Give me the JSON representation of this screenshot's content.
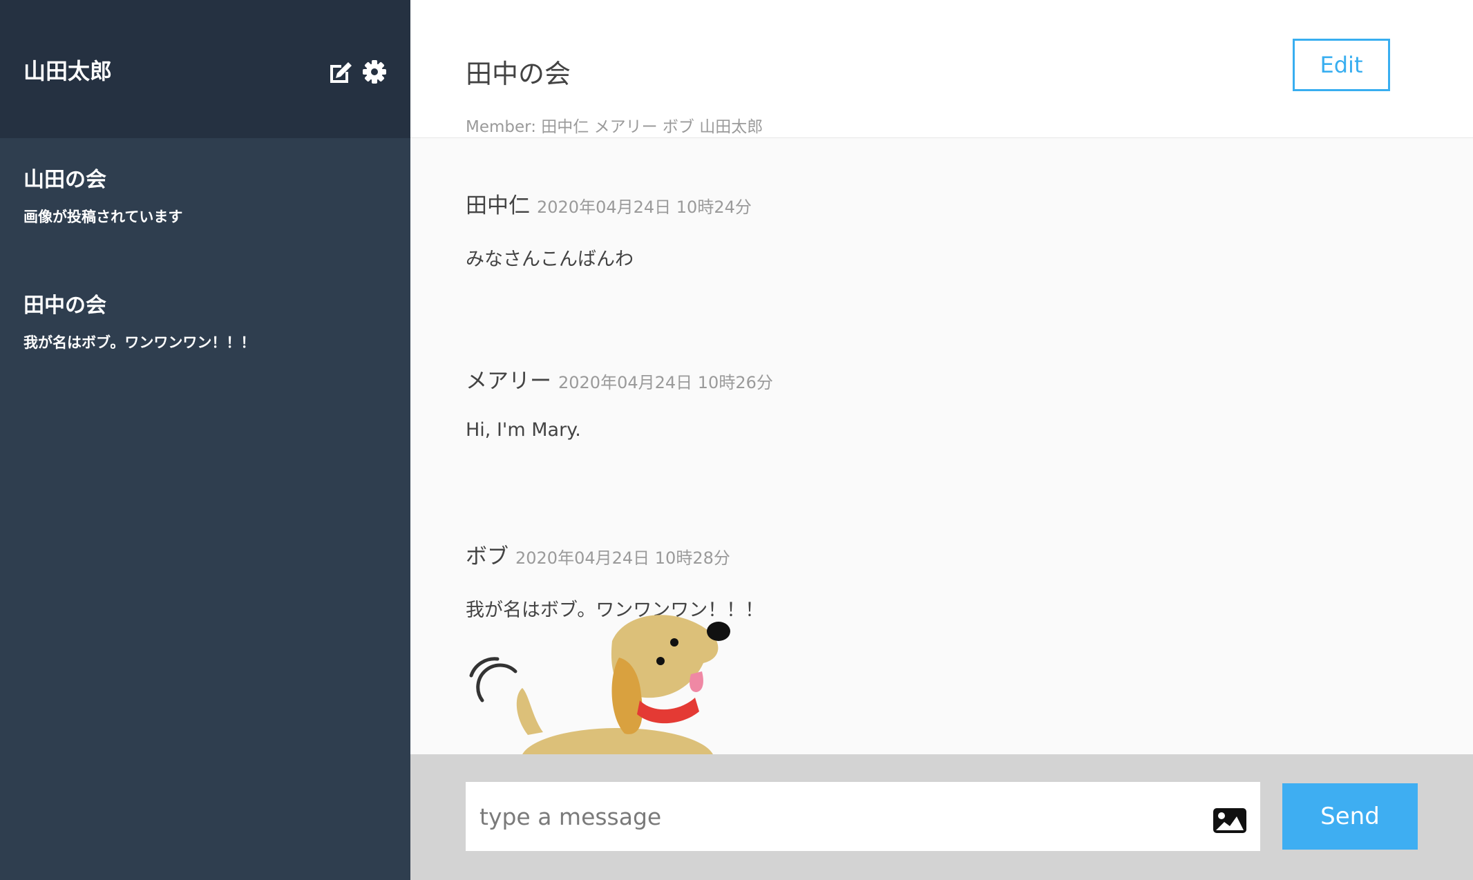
{
  "sidebar": {
    "user_name": "山田太郎",
    "icons": [
      "edit-icon",
      "gear-icon"
    ],
    "groups": [
      {
        "name": "山田の会",
        "last_message": "画像が投稿されています"
      },
      {
        "name": "田中の会",
        "last_message": "我が名はボブ。ワンワンワン！！！"
      }
    ]
  },
  "room": {
    "title": "田中の会",
    "edit_label": "Edit",
    "members": "Member: 田中仁 メアリー ボブ 山田太郎"
  },
  "messages": [
    {
      "user": "田中仁",
      "time": "2020年04月24日 10時24分",
      "text": "みなさんこんばんわ"
    },
    {
      "user": "メアリー",
      "time": "2020年04月24日 10時26分",
      "text": "Hi, I'm Mary."
    },
    {
      "user": "ボブ",
      "time": "2020年04月24日 10時28分",
      "text": "我が名はボブ。ワンワンワン！！！",
      "image": "dog-illustration"
    }
  ],
  "composer": {
    "placeholder": "type a message",
    "image_icon": "image-icon",
    "send_label": "Send"
  },
  "colors": {
    "sidebar_bg": "#2f3e4f",
    "sidebar_header_bg": "#253141",
    "accent": "#3eaef2",
    "message_area_bg": "#fafafa",
    "input_bar_bg": "#d3d3d3"
  }
}
